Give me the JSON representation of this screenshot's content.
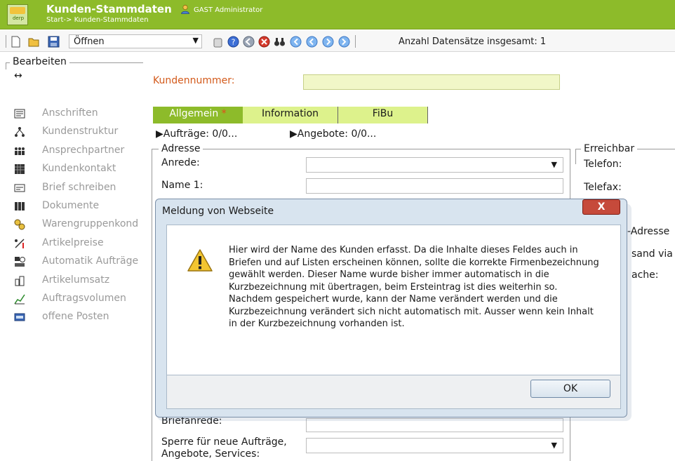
{
  "header": {
    "title": "Kunden-Stammdaten",
    "breadcrumb": "Start-> Kunden-Stammdaten",
    "user": "GAST Administrator",
    "logo_text": "derp"
  },
  "toolbar": {
    "open_select_value": "Öffnen",
    "records_label": "Anzahl Datensätze insgesamt: 1"
  },
  "sidebar": {
    "group_title": "Bearbeiten",
    "expand_glyph": "↔",
    "items": [
      {
        "label": "Anschriften",
        "icon": "address-icon"
      },
      {
        "label": "Kundenstruktur",
        "icon": "hierarchy-icon"
      },
      {
        "label": "Ansprechpartner",
        "icon": "people-icon"
      },
      {
        "label": "Kundenkontakt",
        "icon": "grid-icon"
      },
      {
        "label": "Brief schreiben",
        "icon": "letter-icon"
      },
      {
        "label": "Dokumente",
        "icon": "documents-icon"
      },
      {
        "label": "Warengruppenkond",
        "icon": "coins-icon"
      },
      {
        "label": "Artikelpreise",
        "icon": "price-icon"
      },
      {
        "label": "Automatik Aufträge",
        "icon": "automation-icon"
      },
      {
        "label": "Artikelumsatz",
        "icon": "revenue-icon"
      },
      {
        "label": "Auftragsvolumen",
        "icon": "chart-icon"
      },
      {
        "label": "offene Posten",
        "icon": "open-items-icon"
      }
    ]
  },
  "form": {
    "customer_number_label": "Kundennummer:",
    "tabs": [
      {
        "label": "Allgemein",
        "marker": "*"
      },
      {
        "label": "Information"
      },
      {
        "label": "FiBu"
      }
    ],
    "links": {
      "orders": "Aufträge: 0/0...",
      "offers": "Angebote: 0/0..."
    },
    "address": {
      "title": "Adresse",
      "salutation_label": "Anrede:",
      "name1_label": "Name 1:",
      "letter_salutation_label": "Briefanrede:",
      "lock_label_line1": "Sperre für neue Aufträge,",
      "lock_label_line2": "Angebote, Services:"
    },
    "reachable": {
      "title": "Erreichbar",
      "phone_label": "Telefon:",
      "fax_label": "Telefax:",
      "address_partial": "-Adresse",
      "shipping_partial": "sand via",
      "language_partial": "ache:"
    }
  },
  "dialog": {
    "title": "Meldung von Webseite",
    "close_glyph": "X",
    "message": "Hier wird der Name des Kunden erfasst. Da die Inhalte dieses Feldes auch in Briefen und auf Listen erscheinen können, sollte die korrekte Firmenbezeichnung gewählt werden. Dieser Name wurde bisher immer automatisch in die Kurzbezeichnung mit übertragen, beim Ersteintrag ist dies weiterhin so. Nachdem gespeichert wurde, kann der Name verändert werden und die Kurzbezeichnung verändert sich nicht automatisch mit. Ausser wenn kein Inhalt in der Kurzbezeichnung vorhanden ist.",
    "ok_label": "OK",
    "icon": "warning-icon"
  },
  "colors": {
    "brand_green": "#8dbb2a",
    "tab_inactive": "#ddf28c",
    "accent_orange": "#d35a1b",
    "input_highlight": "#f1f7c8"
  }
}
